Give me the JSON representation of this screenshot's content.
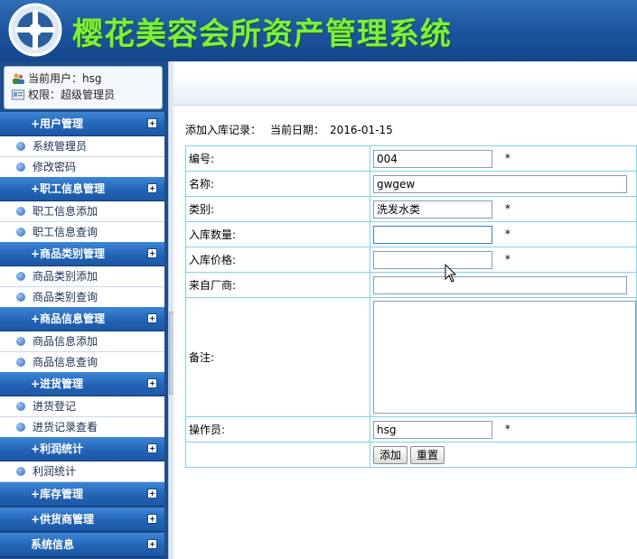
{
  "header": {
    "title": "樱花美容会所资产管理系统"
  },
  "user_box": {
    "current_user_label": "当前用户：",
    "current_user": "hsg",
    "role_label": "权限：",
    "role": "超级管理员",
    "user_icon": "users-icon",
    "role_icon": "id-card-icon"
  },
  "sidebar": {
    "groups": [
      {
        "label": "+用户管理",
        "items": [
          "系统管理员",
          "修改密码"
        ]
      },
      {
        "label": "+职工信息管理",
        "items": [
          "职工信息添加",
          "职工信息查询"
        ]
      },
      {
        "label": "+商品类别管理",
        "items": [
          "商品类别添加",
          "商品类别查询"
        ]
      },
      {
        "label": "+商品信息管理",
        "items": [
          "商品信息添加",
          "商品信息查询"
        ]
      },
      {
        "label": "+进货管理",
        "items": [
          "进货登记",
          "进货记录查看"
        ]
      },
      {
        "label": "+利润统计",
        "items": [
          "利润统计"
        ]
      },
      {
        "label": "+库存管理",
        "items": []
      },
      {
        "label": "+供货商管理",
        "items": []
      },
      {
        "label": "系统信息",
        "items": []
      }
    ]
  },
  "content": {
    "caption": "添加入库记录：",
    "date_label": "当前日期：",
    "date": "2016-01-15",
    "required_mark": "*",
    "fields": {
      "code": {
        "label": "编号:",
        "value": "004"
      },
      "name": {
        "label": "名称:",
        "value": "gwgew"
      },
      "category": {
        "label": "类别:",
        "value": "洗发水类"
      },
      "quantity": {
        "label": "入库数量:",
        "value": ""
      },
      "price": {
        "label": "入库价格:",
        "value": ""
      },
      "supplier": {
        "label": "来自厂商:",
        "value": ""
      },
      "note": {
        "label": "备注:",
        "value": ""
      },
      "operator": {
        "label": "操作员:",
        "value": "hsg"
      }
    },
    "buttons": {
      "add": "添加",
      "reset": "重置"
    }
  },
  "colors": {
    "header_bg": "#1d56a0",
    "title_color": "#7cf03a",
    "menu_head": "#2364b6",
    "table_border": "#7fd2e6"
  }
}
